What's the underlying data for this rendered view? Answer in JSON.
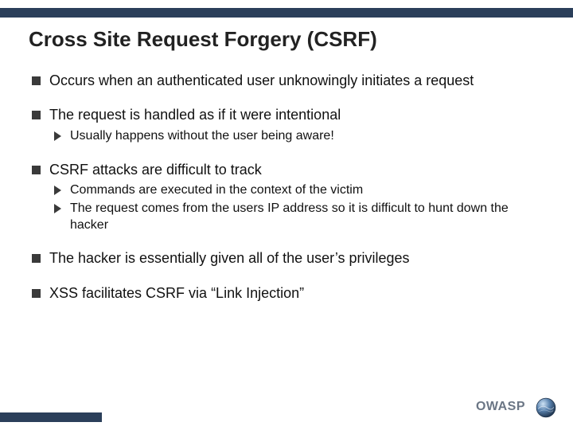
{
  "title": "Cross Site Request Forgery (CSRF)",
  "bullets": [
    {
      "text": "Occurs when an authenticated user unknowingly initiates a request",
      "sub": []
    },
    {
      "text": "The request is handled as if it were intentional",
      "sub": [
        "Usually happens without the user being aware!"
      ]
    },
    {
      "text": "CSRF attacks are difficult to track",
      "sub": [
        "Commands are executed in the context of the victim",
        "The request comes from the users IP address so it is difficult to hunt down the hacker"
      ]
    },
    {
      "text": "The hacker is essentially given all of the user’s privileges",
      "sub": []
    },
    {
      "text": "XSS facilitates CSRF via “Link Injection”",
      "sub": []
    }
  ],
  "footer": {
    "org": "OWASP"
  },
  "colors": {
    "bar": "#2b3f5a",
    "footer_text": "#6b7685"
  }
}
